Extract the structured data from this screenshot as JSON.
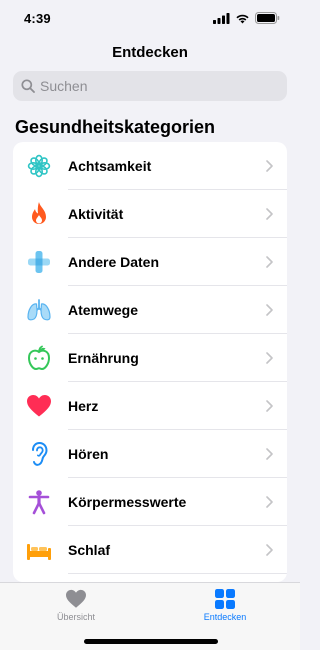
{
  "status_bar": {
    "time": "4:39"
  },
  "nav": {
    "title": "Entdecken"
  },
  "search": {
    "placeholder": "Suchen"
  },
  "section": {
    "title": "Gesundheitskategorien"
  },
  "categories": [
    {
      "label": "Achtsamkeit",
      "icon": "mindfulness-icon",
      "color": "#30c5c5"
    },
    {
      "label": "Aktivität",
      "icon": "flame-icon",
      "color": "#ff5a1f"
    },
    {
      "label": "Andere Daten",
      "icon": "plus-icon",
      "color": "#6cc4f0"
    },
    {
      "label": "Atemwege",
      "icon": "lungs-icon",
      "color": "#5ab4f0"
    },
    {
      "label": "Ernährung",
      "icon": "apple-icon",
      "color": "#34c759"
    },
    {
      "label": "Herz",
      "icon": "heart-icon",
      "color": "#ff2d55"
    },
    {
      "label": "Hören",
      "icon": "ear-icon",
      "color": "#1c8df5"
    },
    {
      "label": "Körpermesswerte",
      "icon": "figure-icon",
      "color": "#a550d8"
    },
    {
      "label": "Schlaf",
      "icon": "bed-icon",
      "color": "#ff9f0a"
    }
  ],
  "tabs": [
    {
      "label": "Übersicht",
      "icon": "heart-icon",
      "active": false,
      "color": "#8e8e93"
    },
    {
      "label": "Entdecken",
      "icon": "grid-icon",
      "active": true,
      "color": "#0a7aff"
    }
  ]
}
